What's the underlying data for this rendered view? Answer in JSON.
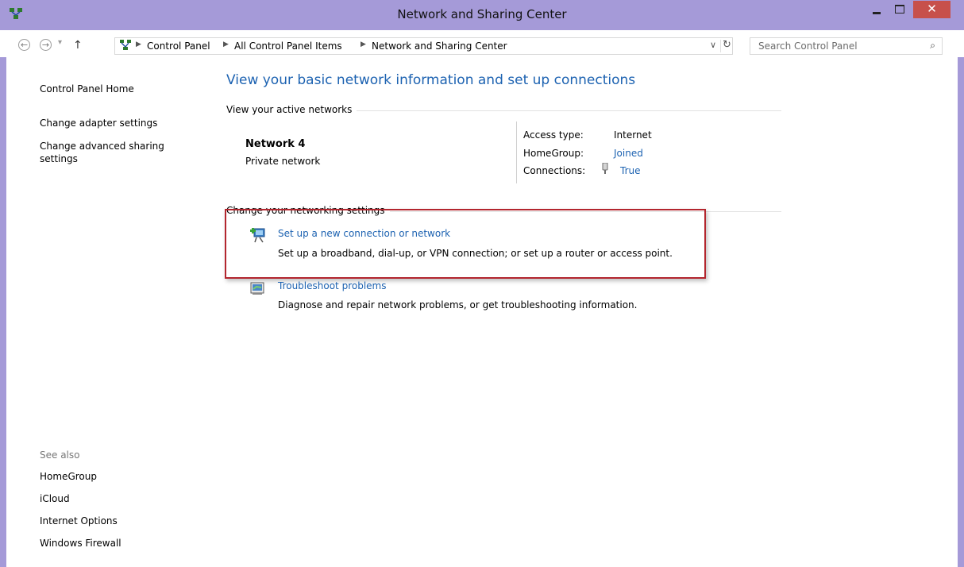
{
  "window": {
    "title": "Network and Sharing Center",
    "close_glyph": "✕",
    "accent": "#a59ad8",
    "close_color": "#c7504b"
  },
  "address": {
    "crumbs": [
      "Control Panel",
      "All Control Panel Items",
      "Network and Sharing Center"
    ],
    "search_placeholder": "Search Control Panel"
  },
  "sidebar": {
    "home": "Control Panel Home",
    "links": [
      "Change adapter settings",
      "Change advanced sharing settings"
    ],
    "see_also_label": "See also",
    "see_also": [
      "HomeGroup",
      "iCloud",
      "Internet Options",
      "Windows Firewall"
    ]
  },
  "main": {
    "heading": "View your basic network information and set up connections",
    "active_networks_label": "View your active networks",
    "network": {
      "name": "Network  4",
      "type": "Private network",
      "access_type_label": "Access type:",
      "access_type_value": "Internet",
      "homegroup_label": "HomeGroup:",
      "homegroup_value": "Joined",
      "connections_label": "Connections:",
      "connections_value": "True"
    },
    "change_settings_label": "Change your networking settings",
    "tasks": [
      {
        "link": "Set up a new connection or network",
        "desc": "Set up a broadband, dial-up, or VPN connection; or set up a router or access point."
      },
      {
        "link": "Troubleshoot problems",
        "desc": "Diagnose and repair network problems, or get troubleshooting information."
      }
    ],
    "highlight_color": "#b3262e",
    "link_color": "#1c62b1"
  }
}
